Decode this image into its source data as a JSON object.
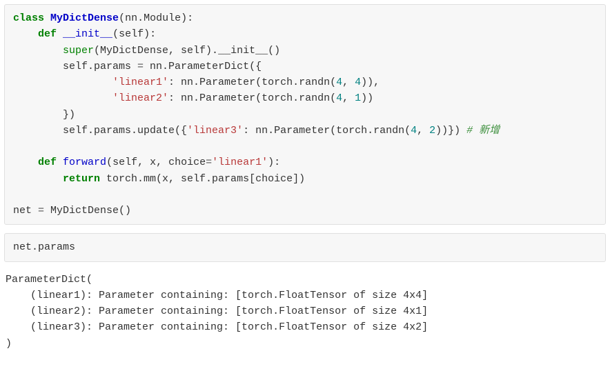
{
  "code1": {
    "class_kw": "class",
    "class_name": "MyDictDense",
    "class_paren_open": "(nn.Module):",
    "def_kw": "def",
    "init_name": "__init__",
    "init_sig": "(self):",
    "super_name": "super",
    "super_args": "(MyDictDense, self).",
    "init_call": "__init__",
    "init_tail": "()",
    "self_params_assign": "        self.params ",
    "eq": "=",
    "nn_paramdict": " nn.ParameterDict({",
    "linear1_str": "'linear1'",
    "nn_param1": ": nn.Parameter(torch.randn(",
    "num4a": "4",
    "comma_sp": ", ",
    "num4b": "4",
    "close_paren2": ")),",
    "linear2_str": "'linear2'",
    "nn_param2": ": nn.Parameter(torch.randn(",
    "num4c": "4",
    "num1": "1",
    "close_paren3": "))",
    "close_brace": "        })",
    "update_line_head": "        self.params.update({",
    "linear3_str": "'linear3'",
    "update_mid": ": nn.Parameter(torch.randn(",
    "num4d": "4",
    "num2": "2",
    "update_tail": "))}) ",
    "comment": "# 新增",
    "forward_name": "forward",
    "forward_sig_open": "(self, x, choice",
    "forward_default": "'linear1'",
    "forward_sig_close": "):",
    "return_kw": "return",
    "return_body": " torch.mm(x, self.params[choice])",
    "net_assign": "net ",
    "net_rhs": " MyDictDense()"
  },
  "code2": {
    "line": "net.params"
  },
  "output": {
    "l1": "ParameterDict(",
    "l2": "    (linear1): Parameter containing: [torch.FloatTensor of size 4x4]",
    "l3": "    (linear2): Parameter containing: [torch.FloatTensor of size 4x1]",
    "l4": "    (linear3): Parameter containing: [torch.FloatTensor of size 4x2]",
    "l5": ")"
  }
}
